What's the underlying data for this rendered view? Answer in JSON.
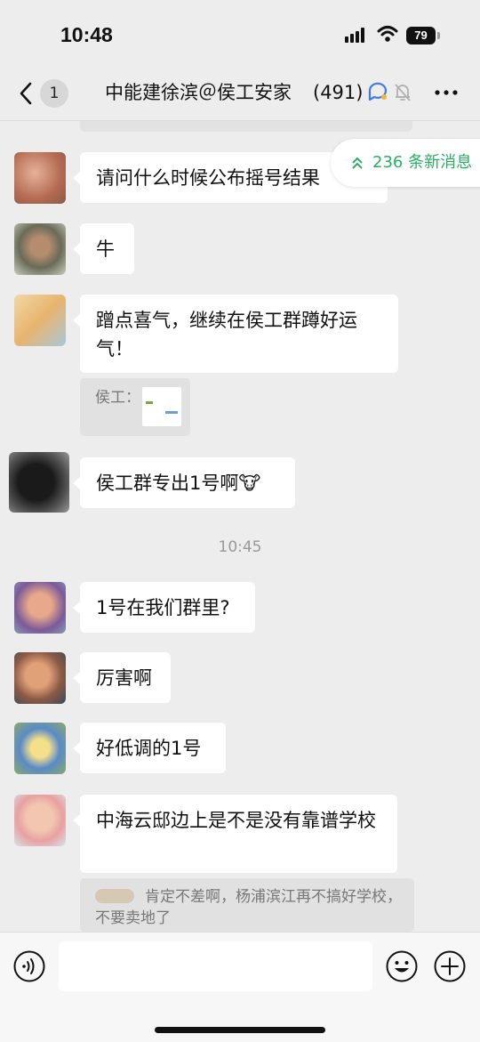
{
  "status_bar": {
    "time": "10:48",
    "battery": "79"
  },
  "nav": {
    "unread_count": "1",
    "title": "中能建徐滨＠侯工安家",
    "member_count": "(491)"
  },
  "new_messages": {
    "label": "236 条新消息"
  },
  "messages": [
    {
      "text": "请问什么时候公布摇号结果"
    },
    {
      "text": "牛"
    },
    {
      "text": "蹭点喜气，继续在侯工群蹲好运气！",
      "quote_author": "侯工："
    },
    {
      "text": "侯工群专出1号啊🐮"
    },
    {
      "text": "1号在我们群里?"
    },
    {
      "text": "厉害啊"
    },
    {
      "text": "好低调的1号"
    },
    {
      "text": "中海云邸边上是不是没有靠谱学校",
      "quote_text": "肯定不差啊，杨浦滨江再不搞好学校，不要卖地了"
    }
  ],
  "timestamp": "10:45",
  "colors": {
    "accent_green": "#2aae67",
    "background": "#ededed",
    "bubble": "#ffffff"
  }
}
